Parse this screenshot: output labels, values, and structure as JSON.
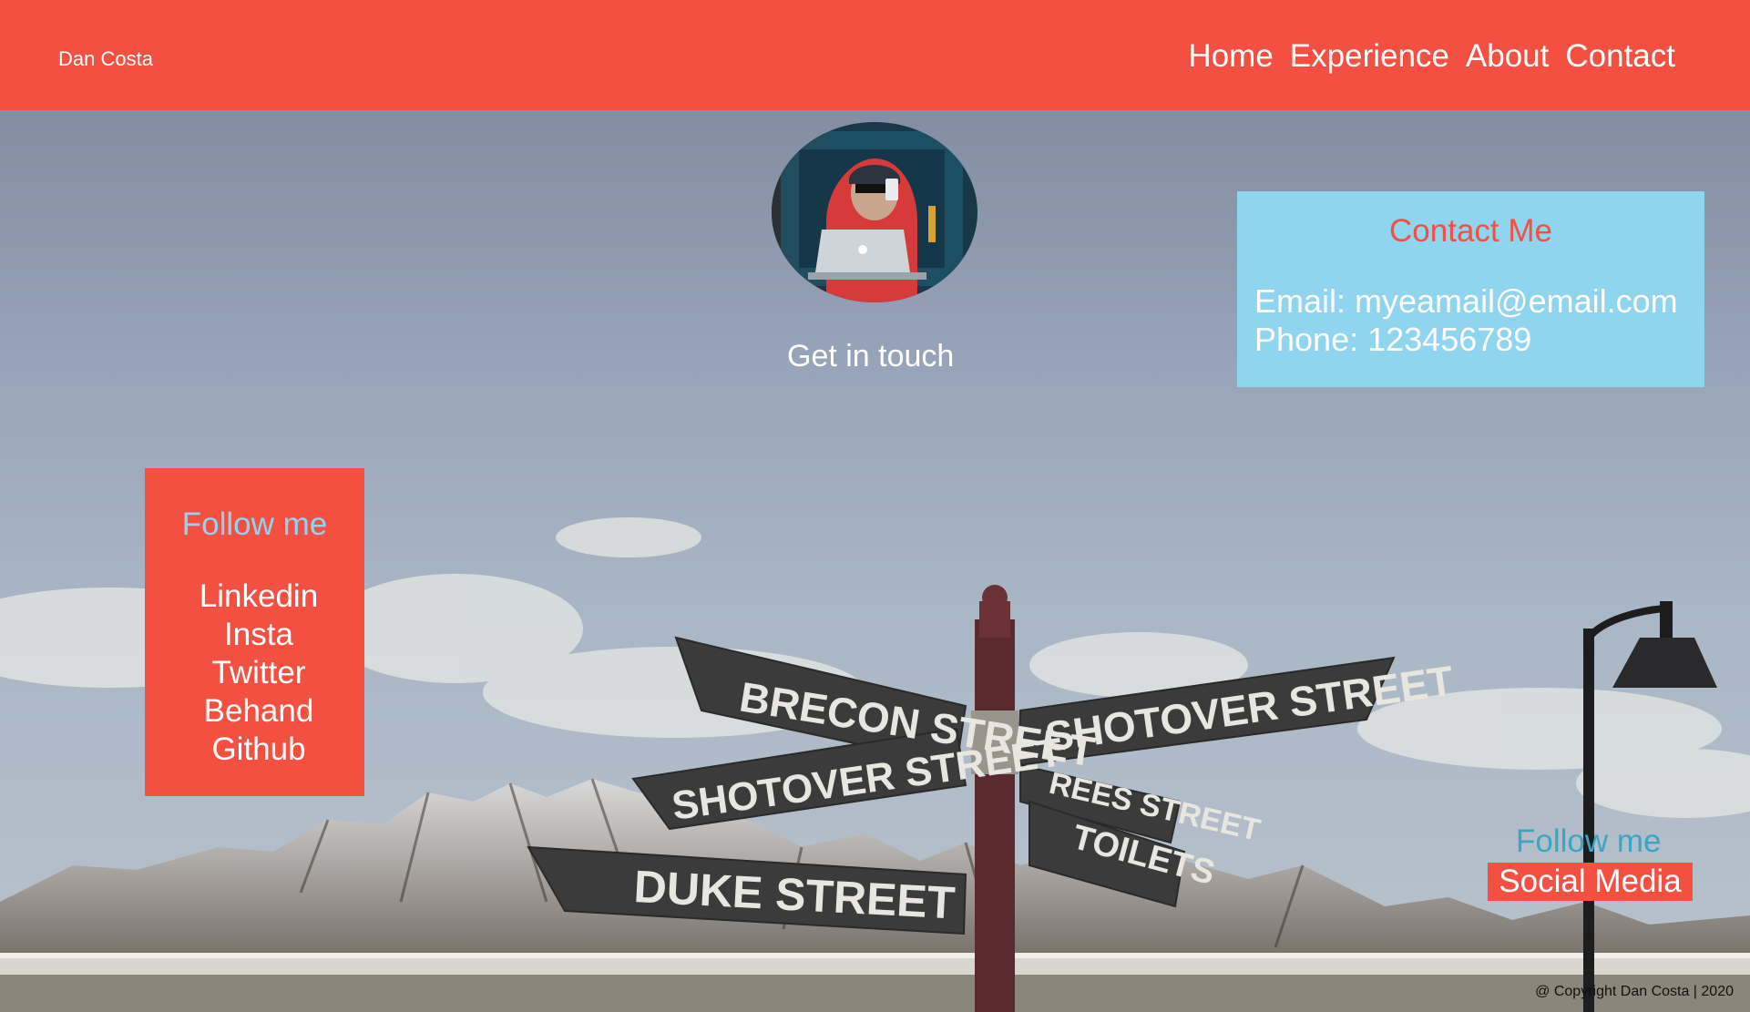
{
  "header": {
    "brand": "Dan Costa",
    "nav": [
      "Home",
      "Experience",
      "About",
      "Contact"
    ]
  },
  "profile": {
    "tagline": "Get in touch"
  },
  "contact": {
    "title": "Contact Me",
    "email_line": "Email: myeamail@email.com",
    "phone_line": "Phone: 123456789"
  },
  "follow": {
    "title": "Follow me",
    "links": [
      "Linkedin",
      "Insta",
      "Twitter",
      "Behand",
      "Github"
    ]
  },
  "social": {
    "title": "Follow me",
    "button_label": "Social Media"
  },
  "footer": {
    "copyright": "@ Copyright Dan Costa | 2020"
  },
  "signs": [
    "BRECON STREET",
    "SHOTOVER STREET",
    "SHOTOVER STREET",
    "REES STREET",
    "DUKE STREET",
    "TOILETS"
  ],
  "colors": {
    "accent": "#f35042",
    "light_blue": "#8fd5f0",
    "teal": "#3ba5c6"
  }
}
